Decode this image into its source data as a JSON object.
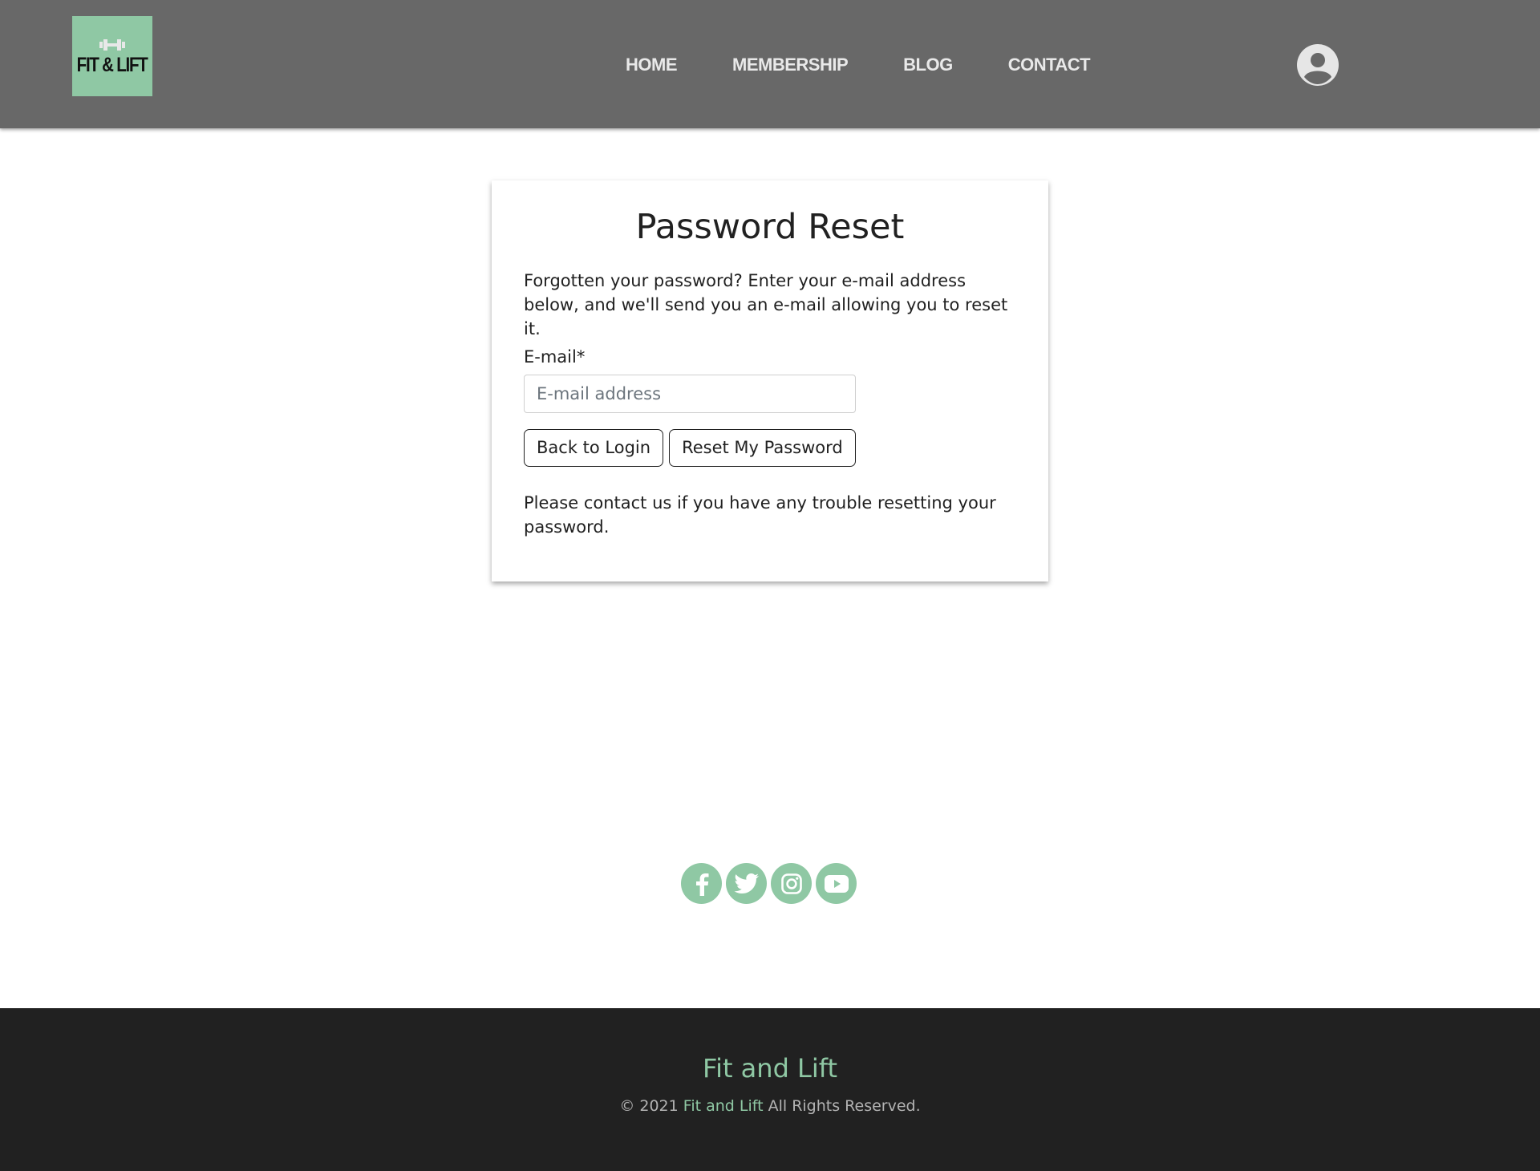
{
  "header": {
    "logo_text": "FIT & LIFT",
    "nav": [
      {
        "label": "HOME"
      },
      {
        "label": "MEMBERSHIP"
      },
      {
        "label": "BLOG"
      },
      {
        "label": "CONTACT"
      }
    ],
    "account_icon": "user-circle-icon"
  },
  "card": {
    "title": "Password Reset",
    "intro": "Forgotten your password? Enter your e-mail address below, and we'll send you an e-mail allowing you to reset it.",
    "email_label": "E-mail*",
    "email_placeholder": "E-mail address",
    "email_value": "",
    "back_button": "Back to Login",
    "reset_button": "Reset My Password",
    "note": "Please contact us if you have any trouble resetting your password."
  },
  "social": [
    "facebook-icon",
    "twitter-icon",
    "instagram-icon",
    "youtube-icon"
  ],
  "footer": {
    "brand": "Fit and Lift",
    "copyright_prefix": "© 2021",
    "copyright_brand": "Fit and Lift",
    "copyright_suffix": "All Rights Reserved."
  },
  "colors": {
    "header_bg": "#686868",
    "accent": "#8fc8a4",
    "footer_bg": "#212121"
  }
}
